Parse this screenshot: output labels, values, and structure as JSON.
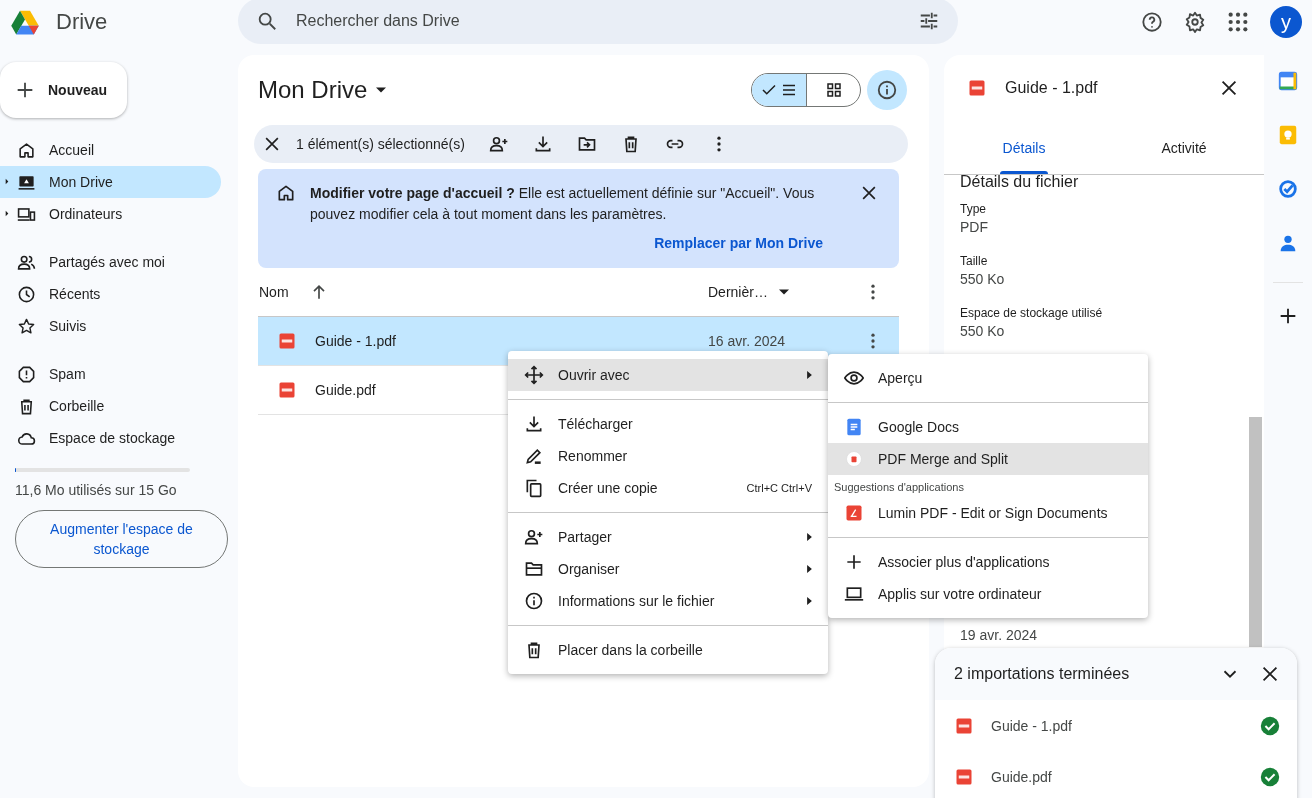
{
  "header": {
    "app_name": "Drive",
    "search": {
      "placeholder": "Rechercher dans Drive"
    },
    "avatar": "y"
  },
  "sidebar": {
    "new_button": "Nouveau",
    "sections": [
      {
        "items": [
          {
            "label": "Accueil",
            "selected": false,
            "expandable": false
          },
          {
            "label": "Mon Drive",
            "selected": true,
            "expandable": true
          },
          {
            "label": "Ordinateurs",
            "selected": false,
            "expandable": true
          }
        ]
      },
      {
        "items": [
          {
            "label": "Partagés avec moi",
            "selected": false,
            "expandable": false
          },
          {
            "label": "Récents",
            "selected": false,
            "expandable": false
          },
          {
            "label": "Suivis",
            "selected": false,
            "expandable": false
          }
        ]
      },
      {
        "items": [
          {
            "label": "Spam",
            "selected": false,
            "expandable": false
          },
          {
            "label": "Corbeille",
            "selected": false,
            "expandable": false
          },
          {
            "label": "Espace de stockage",
            "selected": false,
            "expandable": false
          }
        ]
      }
    ],
    "storage": {
      "level": 0.001,
      "text": "11,6 Mo utilisés sur 15 Go",
      "button": "Augmenter l'espace de stockage"
    }
  },
  "main": {
    "title": "Mon Drive",
    "view_toggle": [
      {
        "selected": true
      },
      {
        "selected": false
      }
    ],
    "details_open": true,
    "selection_bar": {
      "text": "1 élément(s) sélectionné(s)"
    },
    "banner": {
      "text": "**Modifier votre page d'accueil ?** Elle est actuellement définie sur \"Accueil\". Vous pouvez modifier cela à tout moment dans les paramètres.",
      "link": "Remplacer par Mon Drive"
    },
    "table": {
      "columns": [
        "Nom",
        "Dernièr…"
      ],
      "rows": [
        {
          "name": "Guide - 1.pdf",
          "modified": "16 avr. 2024",
          "selected": true
        },
        {
          "name": "Guide.pdf",
          "selected": false
        }
      ]
    }
  },
  "details": {
    "file_name": "Guide - 1.pdf",
    "tabs": [
      {
        "label": "Détails",
        "selected": true
      },
      {
        "label": "Activité",
        "selected": false
      }
    ],
    "section_title": "Détails du fichier",
    "fields": [
      {
        "label": "Type",
        "value": "PDF"
      },
      {
        "label": "Taille",
        "value": "550 Ko"
      },
      {
        "label": "Espace de stockage utilisé",
        "value": "550 Ko"
      }
    ],
    "partial_value": "19 avr. 2024"
  },
  "context_menu": {
    "groups": [
      [
        {
          "label": "Ouvrir avec",
          "submenu": true,
          "selected": true
        }
      ],
      [
        {
          "label": "Télécharger",
          "submenu": false,
          "selected": false
        },
        {
          "label": "Renommer",
          "submenu": false,
          "selected": false
        },
        {
          "label": "Créer une copie",
          "shortcut": "Ctrl+C Ctrl+V",
          "submenu": false,
          "selected": false
        }
      ],
      [
        {
          "label": "Partager",
          "submenu": true,
          "selected": false
        },
        {
          "label": "Organiser",
          "submenu": true,
          "selected": false
        },
        {
          "label": "Informations sur le fichier",
          "submenu": true,
          "selected": false
        }
      ],
      [
        {
          "label": "Placer dans la corbeille",
          "submenu": false,
          "selected": false
        }
      ]
    ]
  },
  "open_with_menu": {
    "groups": [
      [
        {
          "kind": "item",
          "label": "Aperçu",
          "selected": false
        }
      ],
      [
        {
          "kind": "item",
          "label": "Google Docs",
          "selected": false
        },
        {
          "kind": "item",
          "label": "PDF Merge and Split",
          "selected": true
        },
        {
          "kind": "heading",
          "label": "Suggestions d'applications"
        },
        {
          "kind": "item",
          "label": "Lumin PDF - Edit or Sign Documents",
          "selected": false
        }
      ],
      [
        {
          "kind": "item",
          "label": "Associer plus d'applications",
          "selected": false
        },
        {
          "kind": "item",
          "label": "Applis sur votre ordinateur",
          "selected": false
        }
      ]
    ]
  },
  "uploads": {
    "title": "2 importations terminées",
    "items": [
      {
        "name": "Guide - 1.pdf",
        "done": true
      },
      {
        "name": "Guide.pdf",
        "done": true
      }
    ]
  }
}
